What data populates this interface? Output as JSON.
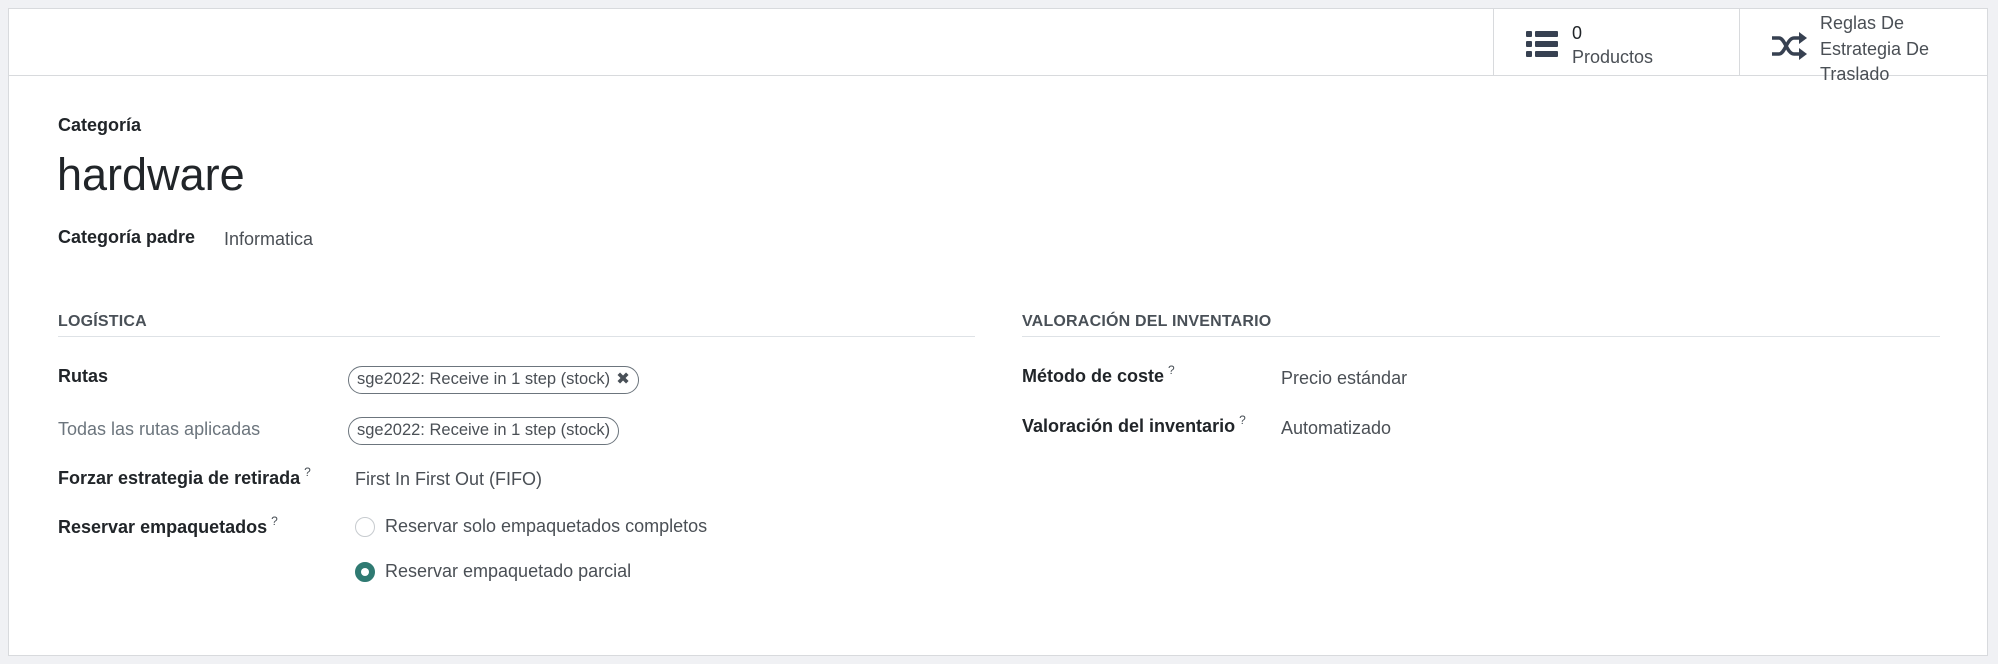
{
  "stat_buttons": {
    "products": {
      "value": "0",
      "label": "Productos",
      "icon": "list-icon"
    },
    "rules": {
      "label": "Reglas De Estrategia De Traslado",
      "icon": "shuffle-icon"
    }
  },
  "record": {
    "name_label": "Categoría",
    "name": "hardware",
    "parent_label": "Categoría padre",
    "parent_value": "Informatica"
  },
  "logistics": {
    "title": "LOGÍSTICA",
    "routes_label": "Rutas",
    "routes_tag": "sge2022: Receive in 1 step (stock)",
    "all_routes_label": "Todas las rutas aplicadas",
    "all_routes_tag": "sge2022: Receive in 1 step (stock)",
    "removal_label": "Forzar estrategia de retirada",
    "removal_value": "First In First Out (FIFO)",
    "packaging_label": "Reservar empaquetados",
    "packaging_options": [
      {
        "label": "Reservar solo empaquetados completos",
        "checked": false
      },
      {
        "label": "Reservar empaquetado parcial",
        "checked": true
      }
    ]
  },
  "valuation": {
    "title": "VALORACIÓN DEL INVENTARIO",
    "cost_method_label": "Método de coste",
    "cost_method_value": "Precio estándar",
    "inventory_valuation_label": "Valoración del inventario",
    "inventory_valuation_value": "Automatizado"
  },
  "help_mark": "?",
  "colors": {
    "accent": "#2f7a72",
    "text": "#212529",
    "muted": "#6c757d"
  }
}
